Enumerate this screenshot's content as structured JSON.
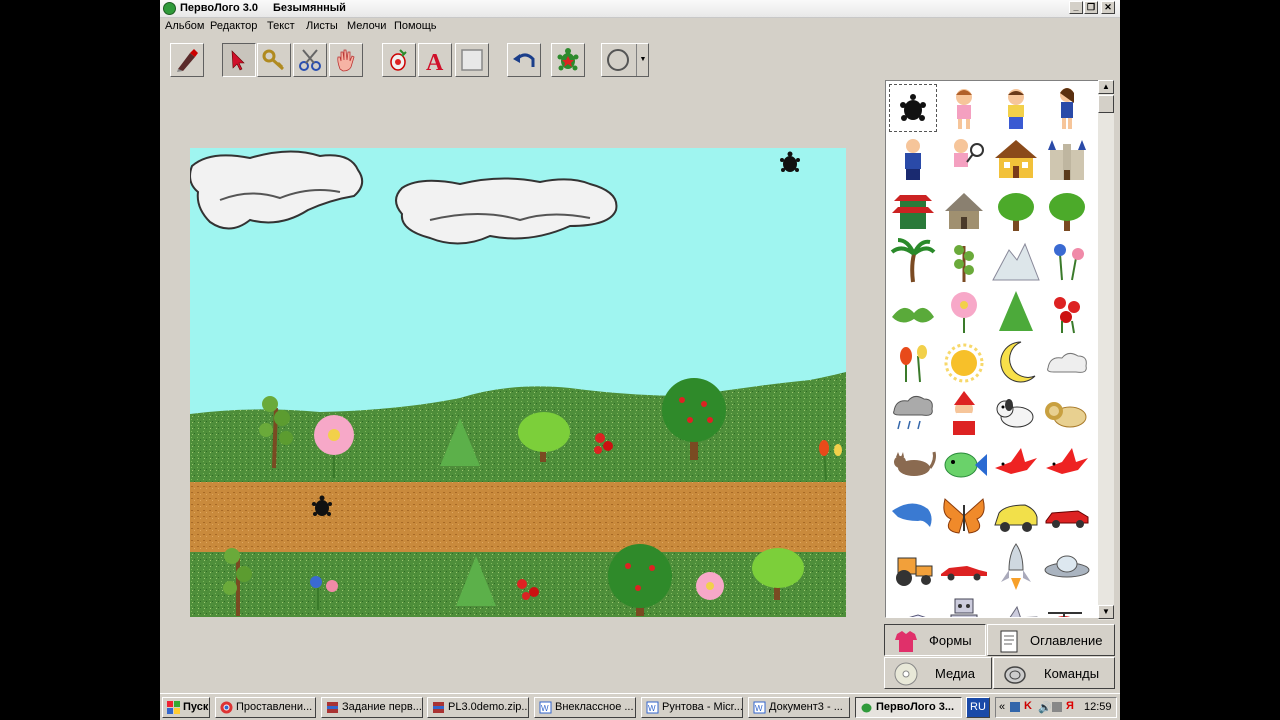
{
  "window": {
    "title": "ПервоЛого 3.0",
    "document": "Безымянный"
  },
  "menu": [
    "Альбом",
    "Редактор",
    "Текст",
    "Листы",
    "Мелочи",
    "Помощь"
  ],
  "toolbar": {
    "tools": [
      {
        "name": "paint-brush-icon"
      },
      {
        "name": "arrow-pointer-icon"
      },
      {
        "name": "key-icon"
      },
      {
        "name": "scissors-icon"
      },
      {
        "name": "hand-icon"
      },
      {
        "name": "new-turtle-icon"
      },
      {
        "name": "text-tool-icon"
      },
      {
        "name": "textbox-icon"
      },
      {
        "name": "undo-icon"
      },
      {
        "name": "turtle-icon"
      },
      {
        "name": "shape-selector-icon"
      }
    ]
  },
  "palette": {
    "items": [
      "turtle",
      "girl",
      "boy",
      "schoolgirl",
      "schoolboy",
      "tennis-girl",
      "house",
      "castle",
      "pagoda",
      "hut",
      "tree",
      "tree",
      "palm",
      "thin-tree",
      "mountain",
      "flowers",
      "leaves",
      "pink-flower",
      "fir-tree",
      "red-flowers",
      "tulips",
      "sun",
      "moon",
      "cloud",
      "rain-cloud",
      "santa",
      "dog",
      "lion",
      "cat",
      "fish",
      "red-bird",
      "red-bird",
      "dolphin",
      "butterfly",
      "car",
      "red-car",
      "tractor",
      "sports-car",
      "rocket",
      "ufo",
      "shuttle",
      "robot",
      "airplane",
      "helicopter"
    ],
    "tabs": {
      "shapes": "Формы",
      "contents": "Оглавление",
      "media": "Медиа",
      "commands": "Команды"
    }
  },
  "taskbar": {
    "start": "Пуск",
    "tasks": [
      "Проставлени...",
      "Задание перв...",
      "PL3.0demo.zip...",
      "Внеклассное ...",
      "Рунтова - Micr...",
      "Документ3 - ...",
      "ПервоЛого 3..."
    ],
    "lang": "RU",
    "clock": "12:59"
  },
  "colors": {
    "sky": "#9ff5f0",
    "grass": "#4f8e3a",
    "road": "#c98a3c",
    "face": "#d4d0c8"
  }
}
